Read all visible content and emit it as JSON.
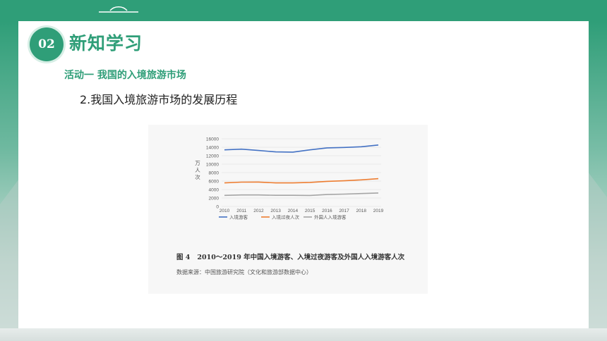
{
  "header": {
    "badge": "02",
    "section_title": "新知学习"
  },
  "activity": "活动一  我国的入境旅游市场",
  "subheading": "2.我国入境旅游市场的发展历程",
  "figure": {
    "number": "图 4",
    "caption": "2010～2019 年中国入境游客、入境过夜游客及外国人入境游客人次",
    "source": "数据来源：中国旅游研究院（文化和旅游部数据中心）"
  },
  "colors": {
    "brand": "#2f9e78",
    "series_blue": "#4472c4",
    "series_orange": "#ed7d31",
    "series_gray": "#a5a5a5"
  },
  "chart_data": {
    "type": "line",
    "x": [
      "2010",
      "2011",
      "2012",
      "2013",
      "2014",
      "2015",
      "2016",
      "2017",
      "2018",
      "2019"
    ],
    "ylabel": "万人次",
    "ylim": [
      0,
      16000
    ],
    "yticks": [
      "0",
      "2000",
      "4000",
      "6000",
      "8000",
      "10000",
      "12000",
      "14000",
      "16000"
    ],
    "grid": true,
    "legend_position": "bottom",
    "series": [
      {
        "name": "入境游客",
        "color": "#4472c4",
        "values": [
          13376,
          13542,
          13241,
          12908,
          12850,
          13382,
          13844,
          13948,
          14120,
          14531
        ]
      },
      {
        "name": "入境过夜人次",
        "color": "#ed7d31",
        "values": [
          5567,
          5758,
          5772,
          5569,
          5562,
          5689,
          5927,
          6074,
          6290,
          6573
        ]
      },
      {
        "name": "外国人入境游客",
        "color": "#a5a5a5",
        "values": [
          2613,
          2712,
          2719,
          2629,
          2636,
          2599,
          2815,
          2917,
          3054,
          3188
        ]
      }
    ]
  }
}
